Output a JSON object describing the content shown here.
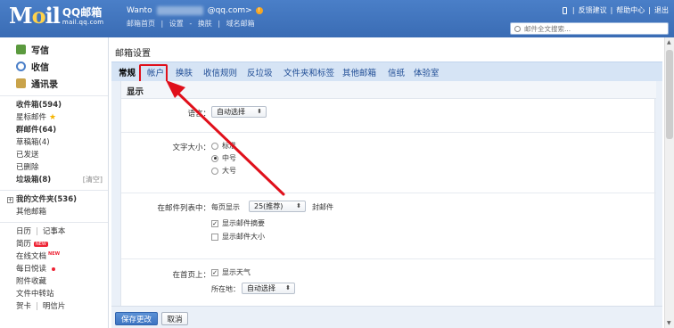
{
  "header": {
    "logo_big": "M",
    "logo_o": "o",
    "logo_il": "il",
    "logo_qq": "QQ邮箱",
    "logo_domain": "mail.qq.com",
    "user_name": "Wanto",
    "user_domain": "@qq.com>",
    "links": [
      "邮箱首页",
      "|",
      "设置",
      "-",
      "换肤",
      "|",
      "域名邮箱"
    ],
    "top_right": [
      "|",
      "反馈建议",
      "|",
      "帮助中心",
      "|",
      "退出"
    ],
    "search_placeholder": "邮件全文搜索..."
  },
  "sidebar": {
    "compose": "写信",
    "inbox": "收信",
    "contacts": "通讯录",
    "folders": [
      {
        "label": "收件箱(594)",
        "bold": true
      },
      {
        "label": "星标邮件",
        "bold": false
      },
      {
        "label": "群邮件(64)",
        "bold": true
      },
      {
        "label": "草稿箱(4)",
        "bold": false
      },
      {
        "label": "已发送",
        "bold": false
      },
      {
        "label": "已删除",
        "bold": false
      },
      {
        "label": "垃圾箱(8)",
        "bold": true
      }
    ],
    "clear_label": "[清空]",
    "my_folders": "我的文件夹(536)",
    "other_mailbox": "其他邮箱",
    "calendar": "日历",
    "notes": "记事本",
    "resume": "简历",
    "new_badge": "NEW",
    "online_doc": "在线文档",
    "daily_read": "每日悦读",
    "attachments": "附件收藏",
    "file_transfer": "文件中转站",
    "cards": "贺卡",
    "postcard": "明信片"
  },
  "main": {
    "title": "邮箱设置",
    "tabs": [
      "常规",
      "帐户",
      "换肤",
      "收信规则",
      "反垃圾",
      "文件夹和标签",
      "其他邮箱",
      "信纸",
      "体验室"
    ],
    "section": "显示",
    "language_label": "语言：",
    "language_value": "自动选择",
    "fontsize_label": "文字大小：",
    "fontsize_options": [
      "标准",
      "中号",
      "大号"
    ],
    "fontsize_selected": 1,
    "list_label": "在邮件列表中：",
    "per_page_prefix": "每页显示",
    "per_page_value": "25(推荐)",
    "per_page_suffix": "封邮件",
    "show_summary": "显示邮件摘要",
    "show_size": "显示邮件大小",
    "home_label": "在首页上：",
    "show_weather": "显示天气",
    "location_label": "所在地：",
    "location_value": "自动选择",
    "save_btn": "保存更改",
    "cancel_btn": "取消"
  },
  "colors": {
    "header_bg": "#3a6cb4",
    "tab_bar_bg": "#d6e4f5",
    "annotation_red": "#e0101b",
    "save_btn_bg": "#3d74c2"
  }
}
